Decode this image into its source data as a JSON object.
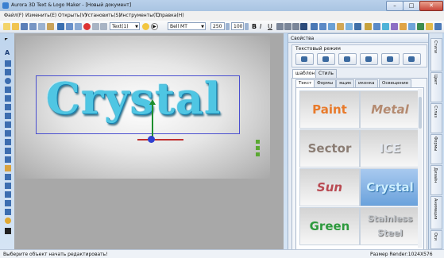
{
  "window": {
    "title": "Aurora 3D Text & Logo Maker - [Новый документ]",
    "controls": {
      "minimize": "–",
      "maximize": "□",
      "close": "✕"
    }
  },
  "menu": [
    "Файл(F)",
    "Изменить(E)",
    "Открыть(V)",
    "Установить(S)",
    "Инструменты(T)",
    "Справка(H)"
  ],
  "toolbar": {
    "text_combo": "Text(1)",
    "font_combo": "Bell MT",
    "size_value": "250",
    "zoom_value": "100",
    "bold": "B",
    "italic": "I",
    "underline": "U"
  },
  "canvas": {
    "text": "Crystal",
    "colors": {
      "text": "#4fc6e3",
      "selection": "#4a4fd0"
    }
  },
  "panel": {
    "title": "Свойства",
    "mode_group_label": "Текстовый режим",
    "main_tabs": [
      "шаблон",
      "Стиль"
    ],
    "sub_tabs": [
      "Текст",
      "Формы",
      "ящик",
      "иконка",
      "Освещение"
    ],
    "gallery": [
      "Paint",
      "Metal",
      "Sector",
      "ICE",
      "Sun",
      "Crystal",
      "Green",
      "Stainless Steel"
    ]
  },
  "side_tabs": [
    "Стили",
    "Цвет",
    "Сглаз",
    "Формы",
    "Дизайн",
    "Анимация",
    "Оси"
  ],
  "status": {
    "left": "Выберите объект начать редактировать!",
    "right": "Размер Render:1024X576"
  }
}
